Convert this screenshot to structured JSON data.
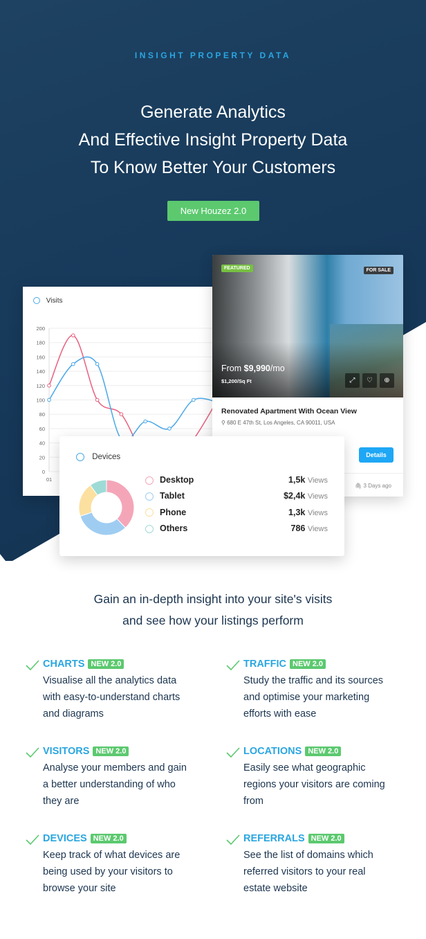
{
  "hero": {
    "eyebrow": "INSIGHT PROPERTY DATA",
    "headline": [
      "Generate Analytics",
      "And Effective Insight Property Data",
      "To Know Better Your Customers"
    ],
    "button": "New Houzez 2.0"
  },
  "visits_card": {
    "title": "Visits",
    "y_ticks": [
      "0",
      "20",
      "40",
      "60",
      "80",
      "100",
      "120",
      "140",
      "160",
      "180",
      "200"
    ],
    "x_first_label": "01"
  },
  "chart_data": {
    "type": "line",
    "ylim": [
      0,
      200
    ],
    "x_labels": [
      "01"
    ],
    "series": [
      {
        "color": "#e8607f",
        "values": [
          120,
          190,
          100,
          80,
          20,
          10,
          45,
          100
        ]
      },
      {
        "color": "#4aa8e8",
        "values": [
          100,
          150,
          150,
          45,
          70,
          60,
          100,
          97
        ]
      }
    ]
  },
  "property": {
    "featured": "FEATURED",
    "status": "FOR SALE",
    "price_prefix": "From ",
    "price": "$9,990",
    "price_suffix": "/mo",
    "price_sqft": "$1,200/Sq Ft",
    "title": "Renovated Apartment With Ocean View",
    "address": "680 E 47th St, Los Angeles, CA 90011, USA",
    "details_button": "Details",
    "date": "3 Days ago"
  },
  "devices_card": {
    "title": "Devices",
    "unit": "Views",
    "items": [
      {
        "label": "Desktop",
        "value": "1,5k",
        "color": "#f4a6b8",
        "share": 38
      },
      {
        "label": "Tablet",
        "value": "$2,4k",
        "color": "#9fcdf2",
        "share": 32
      },
      {
        "label": "Phone",
        "value": "1,3k",
        "color": "#fbe0a0",
        "share": 20
      },
      {
        "label": "Others",
        "value": "786",
        "color": "#9edbd6",
        "share": 10
      }
    ]
  },
  "subtitle": [
    "Gain an in-depth insight into your site's visits",
    "and see how your listings perform"
  ],
  "features": [
    {
      "title": "CHARTS",
      "badge": "NEW 2.0",
      "desc": [
        "Visualise all the analytics data",
        "with easy-to-understand charts",
        "and diagrams"
      ]
    },
    {
      "title": "TRAFFIC",
      "badge": "NEW 2.0",
      "desc": [
        "Study the traffic and its sources",
        "and optimise your marketing",
        "efforts with ease"
      ]
    },
    {
      "title": "VISITORS",
      "badge": "NEW 2.0",
      "desc": [
        "Analyse your members and gain",
        "a better understanding of who",
        "they are"
      ]
    },
    {
      "title": "LOCATIONS",
      "badge": "NEW 2.0",
      "desc": [
        "Easily see what geographic",
        "regions your visitors are coming",
        "from"
      ]
    },
    {
      "title": "DEVICES",
      "badge": "NEW 2.0",
      "desc": [
        "Keep track of what devices are",
        "being used by your visitors to",
        "browse your site"
      ]
    },
    {
      "title": "REFERRALS",
      "badge": "NEW 2.0",
      "desc": [
        "See the list of domains which",
        "referred visitors to your real",
        "estate website"
      ]
    }
  ]
}
